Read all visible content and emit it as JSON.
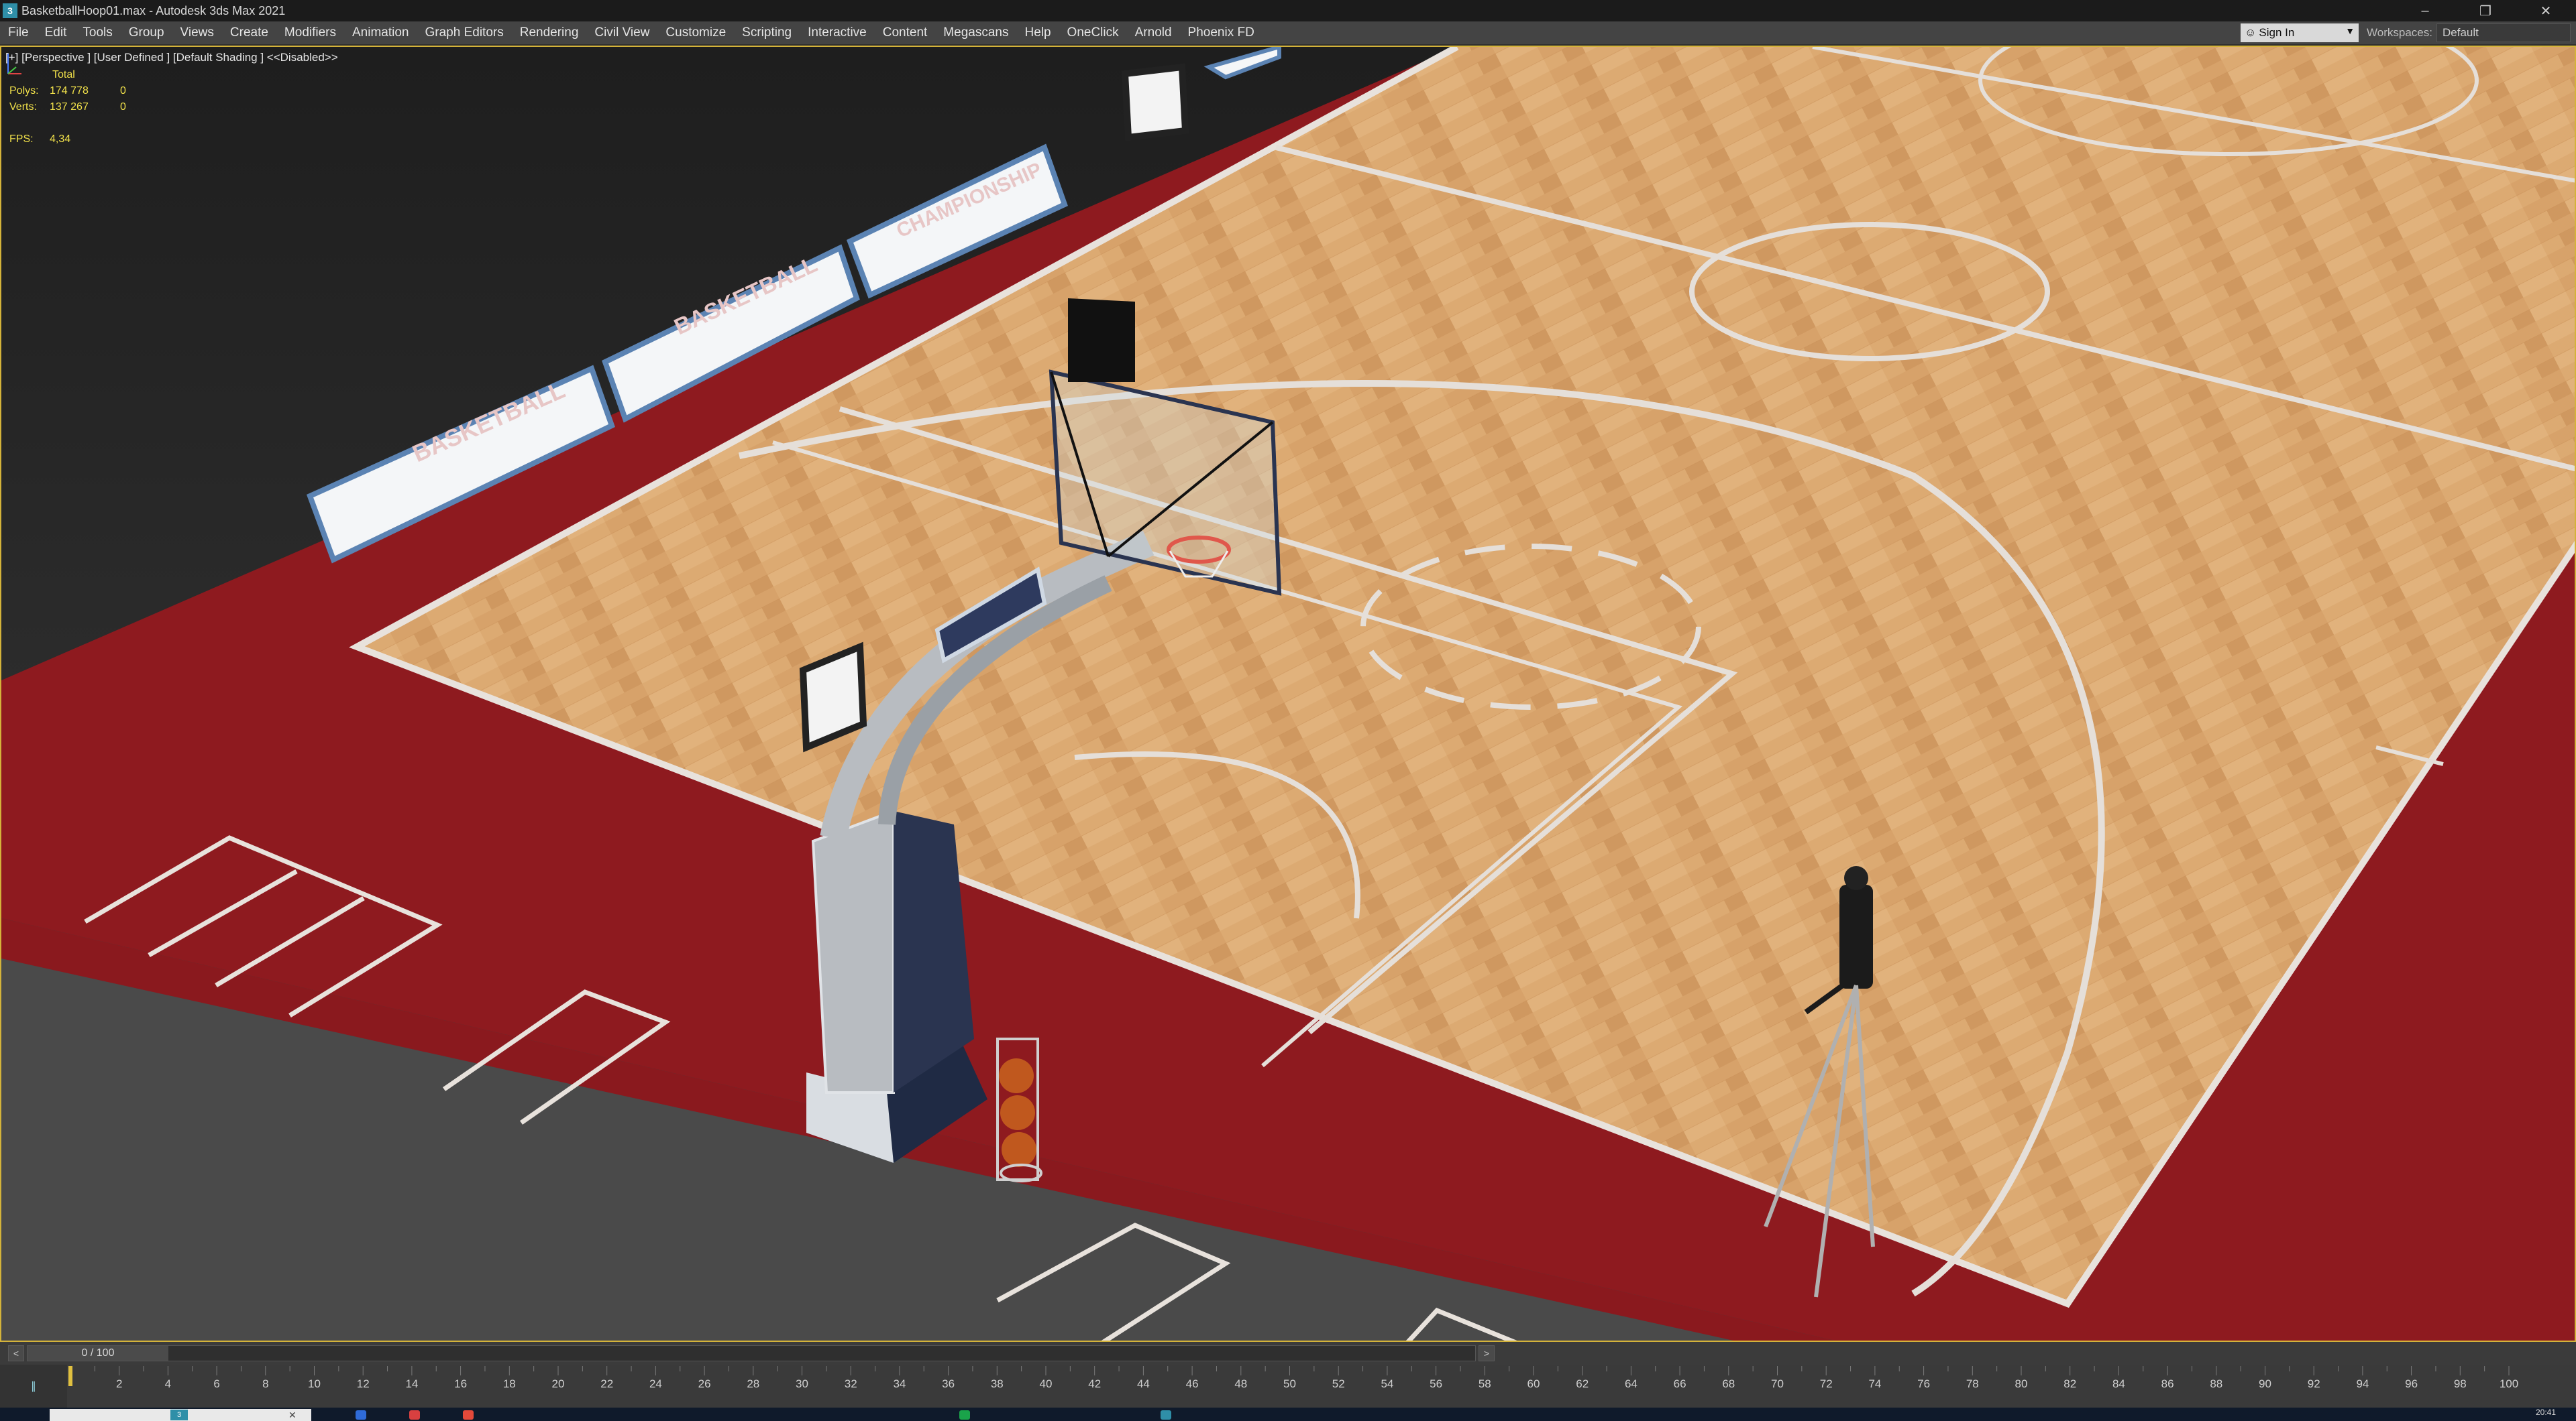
{
  "titlebar": {
    "title": "BasketballHoop01.max - Autodesk 3ds Max 2021",
    "icon": "3ds-max-icon",
    "controls": [
      "minimize",
      "restore",
      "close"
    ]
  },
  "menubar": {
    "items": [
      "File",
      "Edit",
      "Tools",
      "Group",
      "Views",
      "Create",
      "Modifiers",
      "Animation",
      "Graph Editors",
      "Rendering",
      "Civil View",
      "Customize",
      "Scripting",
      "Interactive",
      "Content",
      "Megascans",
      "Help",
      "OneClick",
      "Arnold",
      "Phoenix FD"
    ],
    "sign_in": "Sign In",
    "workspaces_label": "Workspaces:",
    "workspaces_value": "Default"
  },
  "viewport": {
    "label": "[+] [Perspective ] [User Defined ] [Default Shading ] <<Disabled>>",
    "stats": {
      "header": "Total",
      "polys_label": "Polys:",
      "polys_value": "174 778",
      "polys_sel": "0",
      "verts_label": "Verts:",
      "verts_value": "137 267",
      "verts_sel": "0",
      "fps_label": "FPS:",
      "fps_value": "4,34"
    },
    "banner_texts": [
      "BASKETBALL",
      "BASKETBALL",
      "CHAMPIONSHIP"
    ],
    "colors": {
      "floor_red": "#8e1a1f",
      "court_wood": "#d9a36a",
      "court_lines": "#e8e2dc",
      "background": "#2a2a2a",
      "viewport_border": "#d4b33a"
    }
  },
  "timeslider": {
    "prev": "<",
    "next": ">",
    "frame": "0 / 100"
  },
  "trackbar": {
    "ticks": [
      "2",
      "4",
      "6",
      "8",
      "10",
      "12",
      "14",
      "16",
      "18",
      "20",
      "22",
      "24",
      "26",
      "28",
      "30",
      "32",
      "34",
      "36",
      "38",
      "40",
      "42",
      "44",
      "46",
      "48",
      "50",
      "52",
      "54",
      "56",
      "58",
      "60",
      "62",
      "64",
      "66",
      "68",
      "70",
      "72",
      "74",
      "76",
      "78",
      "80",
      "82",
      "84",
      "86",
      "88",
      "90",
      "92",
      "94",
      "96",
      "98",
      "100"
    ]
  },
  "taskbar": {
    "clock": "20:41"
  }
}
